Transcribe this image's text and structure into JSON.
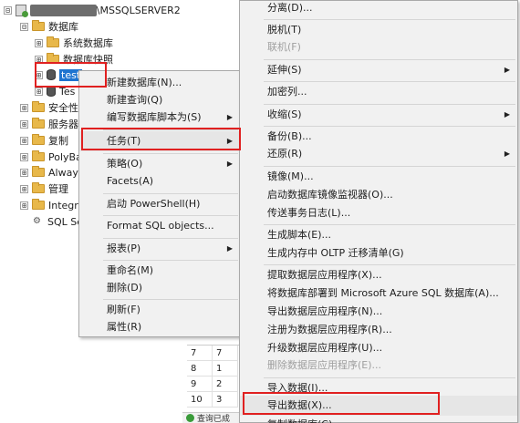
{
  "tree": {
    "server_label": "■■■■■■■",
    "server_instance": "\\MSSQLSERVER2",
    "databases": "数据库",
    "system_db": "系统数据库",
    "snapshots": "数据库快照",
    "selected_db": "test",
    "db2": "Tes",
    "security": "安全性",
    "server_objects": "服务器",
    "replication": "复制",
    "polybase": "PolyBa",
    "always": "Always",
    "management": "管理",
    "integration": "Integr",
    "sql_agent": "SQL Se",
    "expand": "⊞",
    "collapse": "⊟"
  },
  "grid": {
    "rows": [
      [
        "7",
        "7"
      ],
      [
        "8",
        "1"
      ],
      [
        "9",
        "2"
      ],
      [
        "10",
        "3"
      ]
    ],
    "status": "查询已成"
  },
  "context_menu": {
    "items": [
      {
        "label": "新建数据库(N)..."
      },
      {
        "label": "新建查询(Q)"
      },
      {
        "label": "编写数据库脚本为(S)"
      },
      {
        "label": "任务(T)"
      },
      {
        "label": "策略(O)"
      },
      {
        "label": "Facets(A)"
      },
      {
        "label": "启动 PowerShell(H)"
      },
      {
        "label": "Format SQL objects..."
      },
      {
        "label": "报表(P)"
      },
      {
        "label": "重命名(M)"
      },
      {
        "label": "删除(D)"
      },
      {
        "label": "刷新(F)"
      },
      {
        "label": "属性(R)"
      }
    ]
  },
  "tasks_menu": {
    "items": [
      {
        "label": "分离(D)..."
      },
      {
        "label": "脱机(T)"
      },
      {
        "label": "联机(F)"
      },
      {
        "label": "延伸(S)"
      },
      {
        "label": "加密列..."
      },
      {
        "label": "收缩(S)"
      },
      {
        "label": "备份(B)..."
      },
      {
        "label": "还原(R)"
      },
      {
        "label": "镜像(M)..."
      },
      {
        "label": "启动数据库镜像监视器(O)..."
      },
      {
        "label": "传送事务日志(L)..."
      },
      {
        "label": "生成脚本(E)..."
      },
      {
        "label": "生成内存中 OLTP 迁移清单(G)"
      },
      {
        "label": "提取数据层应用程序(X)..."
      },
      {
        "label": "将数据库部署到 Microsoft Azure SQL 数据库(A)..."
      },
      {
        "label": "导出数据层应用程序(N)..."
      },
      {
        "label": "注册为数据层应用程序(R)..."
      },
      {
        "label": "升级数据层应用程序(U)..."
      },
      {
        "label": "删除数据层应用程序(E)..."
      },
      {
        "label": "导入数据(I)..."
      },
      {
        "label": "导出数据(X)..."
      },
      {
        "label": "复制数据库(C)..."
      }
    ]
  },
  "colors": {
    "highlight_box": "#e02020",
    "menu_bg": "#f1f1f1",
    "selection": "#1e74d0"
  }
}
